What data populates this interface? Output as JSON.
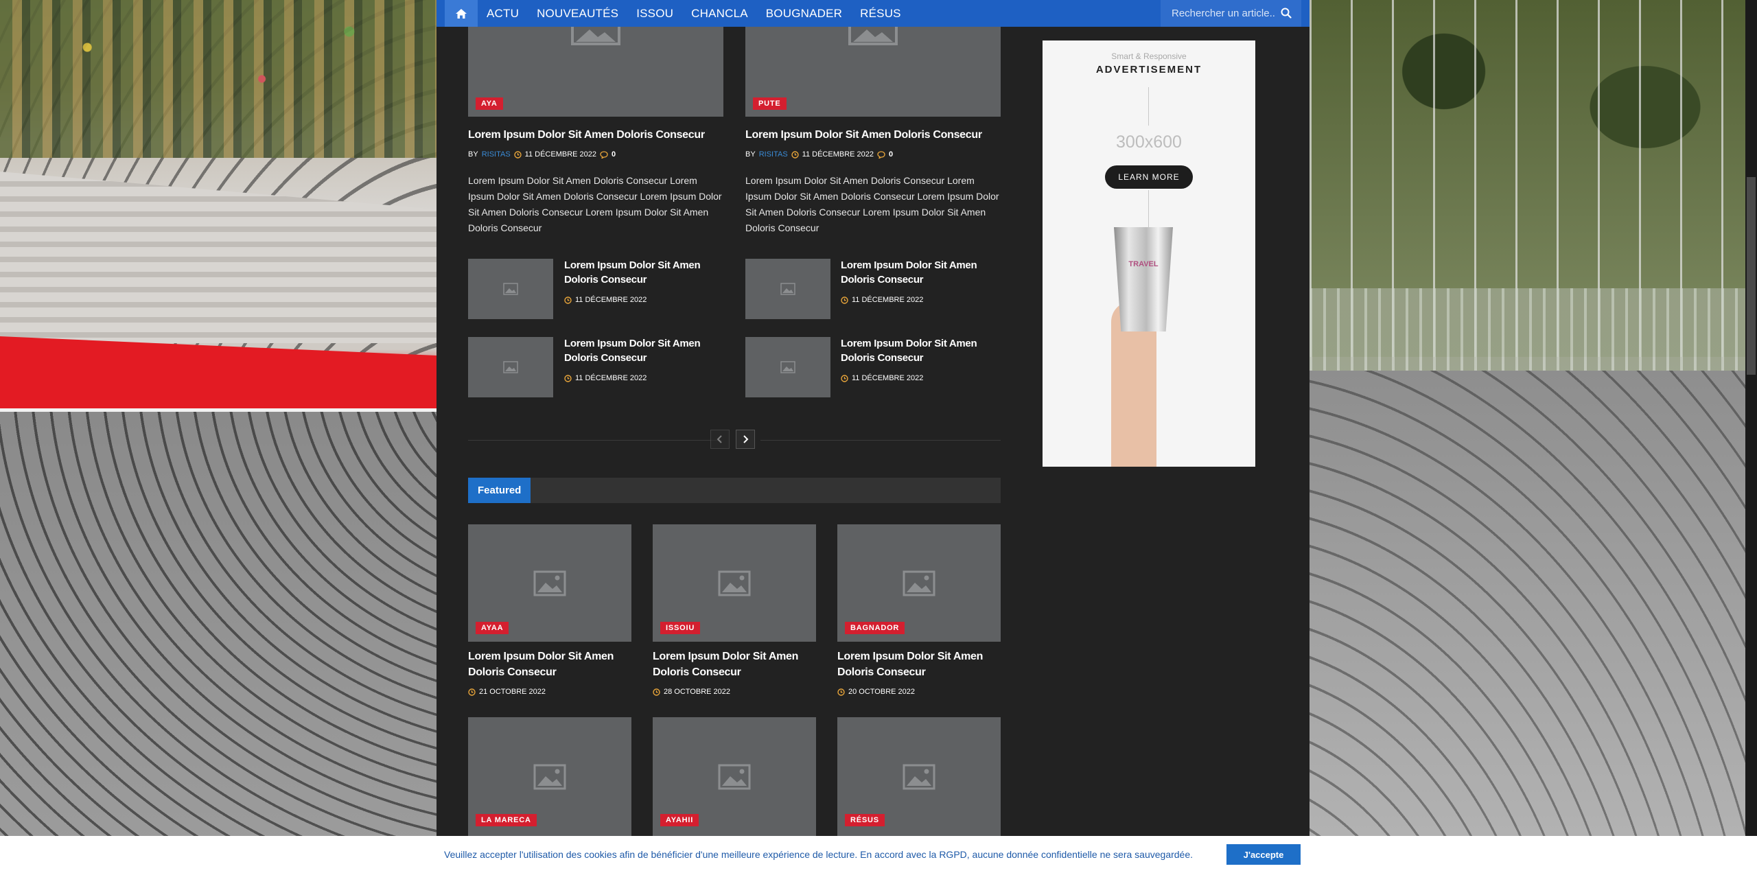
{
  "nav": {
    "items": [
      "ACTU",
      "NOUVEAUTÉS",
      "ISSOU",
      "CHANCLA",
      "BOUGNADER",
      "RÉSUS"
    ],
    "search_placeholder": "Rechercher un article..."
  },
  "top_articles": [
    {
      "badge": "AYA",
      "title": "Lorem Ipsum Dolor Sit Amen Doloris Consecur",
      "by": "BY",
      "author": "RISITAS",
      "date": "11 DÉCEMBRE 2022",
      "comments": "0",
      "excerpt": "Lorem Ipsum Dolor Sit Amen Doloris Consecur Lorem Ipsum Dolor Sit Amen Doloris Consecur Lorem Ipsum Dolor Sit Amen Doloris Consecur Lorem Ipsum Dolor Sit Amen Doloris Consecur"
    },
    {
      "badge": "PUTE",
      "title": "Lorem Ipsum Dolor Sit Amen Doloris Consecur",
      "by": "BY",
      "author": "RISITAS",
      "date": "11 DÉCEMBRE 2022",
      "comments": "0",
      "excerpt": "Lorem Ipsum Dolor Sit Amen Doloris Consecur Lorem Ipsum Dolor Sit Amen Doloris Consecur Lorem Ipsum Dolor Sit Amen Doloris Consecur Lorem Ipsum Dolor Sit Amen Doloris Consecur"
    }
  ],
  "small_articles": [
    {
      "title": "Lorem Ipsum Dolor Sit Amen Doloris Consecur",
      "date": "11 DÉCEMBRE 2022"
    },
    {
      "title": "Lorem Ipsum Dolor Sit Amen Doloris Consecur",
      "date": "11 DÉCEMBRE 2022"
    },
    {
      "title": "Lorem Ipsum Dolor Sit Amen Doloris Consecur",
      "date": "11 DÉCEMBRE 2022"
    },
    {
      "title": "Lorem Ipsum Dolor Sit Amen Doloris Consecur",
      "date": "11 DÉCEMBRE 2022"
    }
  ],
  "featured": {
    "label": "Featured",
    "items": [
      {
        "badge": "AYAA",
        "title": "Lorem Ipsum Dolor Sit Amen Doloris Consecur",
        "date": "21 OCTOBRE 2022"
      },
      {
        "badge": "ISSOIU",
        "title": "Lorem Ipsum Dolor Sit Amen Doloris Consecur",
        "date": "28 OCTOBRE 2022"
      },
      {
        "badge": "BAGNADOR",
        "title": "Lorem Ipsum Dolor Sit Amen Doloris Consecur",
        "date": "20 OCTOBRE 2022"
      },
      {
        "badge": "LA MARECA"
      },
      {
        "badge": "AYAHII"
      },
      {
        "badge": "RÉSUS"
      }
    ]
  },
  "ad": {
    "small": "Smart & Responsive",
    "title": "ADVERTISEMENT",
    "size": "300x600",
    "cta": "LEARN MORE",
    "cup_text": "TRAVEL"
  },
  "cookie": {
    "message": "Veuillez accepter l'utilisation des cookies afin de bénéficier d'une meilleure expérience de lecture. En accord avec la RGPD, aucune donnée confidentielle ne sera sauvegardée.",
    "button": "J'accepte"
  },
  "colors": {
    "nav": "#1e60c3",
    "badge": "#d41f2f",
    "accent": "#1e6fc8",
    "clock": "#e8a53a",
    "page": "#222222"
  }
}
